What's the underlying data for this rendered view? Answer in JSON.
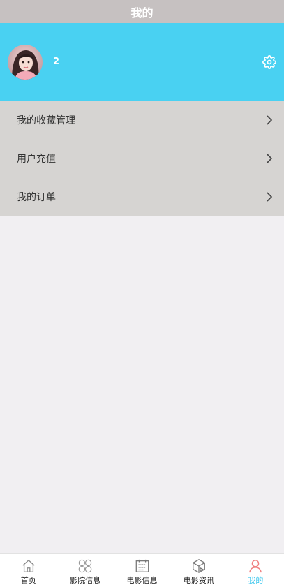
{
  "header": {
    "title": "我的"
  },
  "profile": {
    "username": "2"
  },
  "menu": {
    "items": [
      {
        "label": "我的收藏管理"
      },
      {
        "label": "用户充值"
      },
      {
        "label": "我的订单"
      }
    ]
  },
  "tabbar": {
    "tabs": [
      {
        "label": "首页",
        "icon": "home-icon"
      },
      {
        "label": "影院信息",
        "icon": "grid-icon"
      },
      {
        "label": "电影信息",
        "icon": "calendar-icon"
      },
      {
        "label": "电影资讯",
        "icon": "box-icon"
      },
      {
        "label": "我的",
        "icon": "user-icon",
        "active": true
      }
    ]
  },
  "colors": {
    "header_bg": "#c6c1c1",
    "profile_bg": "#49d1f2",
    "menu_bg": "#d6d4d2",
    "page_bg": "#f1eff2",
    "active_tab": "#37c5ec",
    "active_icon": "#f07f7f"
  }
}
